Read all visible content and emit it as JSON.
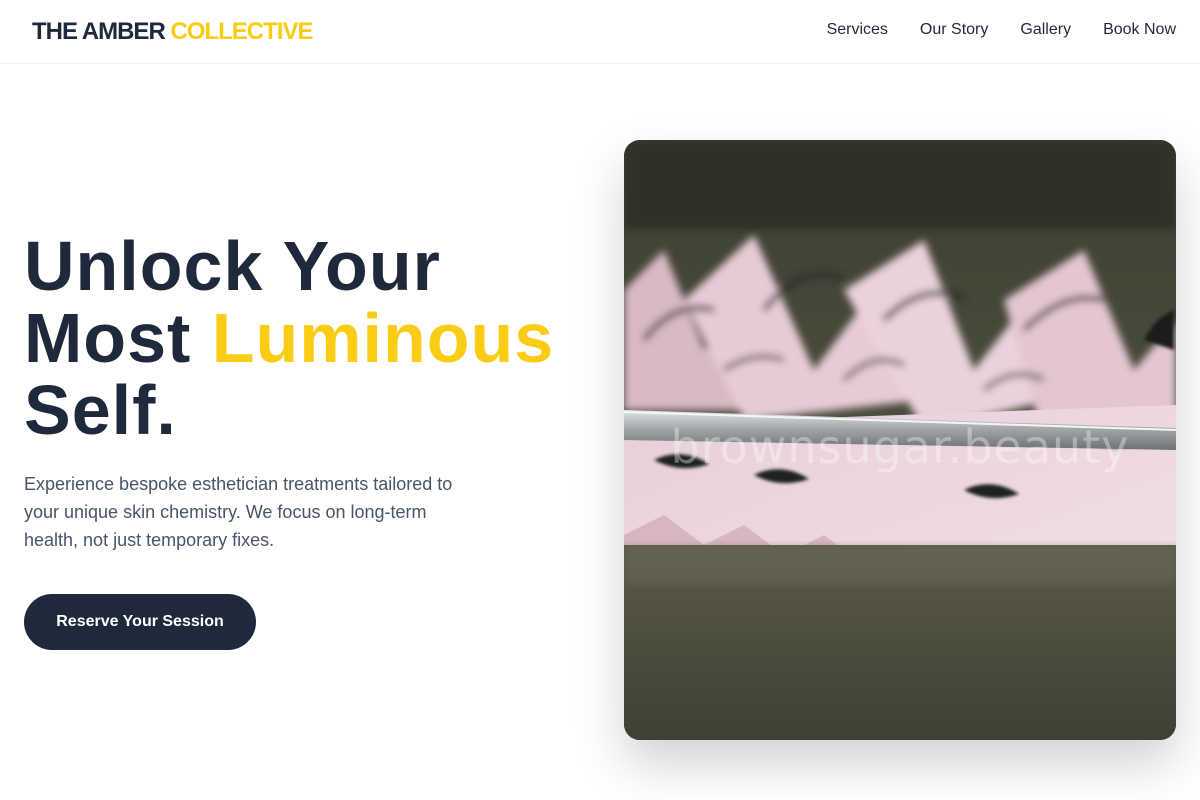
{
  "header": {
    "brand_main": "THE AMBER",
    "brand_accent": "COLLECTIVE",
    "nav": [
      "Services",
      "Our Story",
      "Gallery",
      "Book Now"
    ]
  },
  "hero": {
    "title_line1": "Unlock Your",
    "title_line2_prefix": "Most",
    "title_accent": "Luminous",
    "title_line3": "Self.",
    "description": "Experience bespoke esthetician treatments tailored to your unique skin chemistry. We focus on long-term health, not just temporary fixes.",
    "cta_label": "Reserve Your Session",
    "image_watermark": "brownsugar.beauty"
  },
  "colors": {
    "primary": "#1e293b",
    "accent": "#facc15",
    "text_muted": "#475569"
  }
}
